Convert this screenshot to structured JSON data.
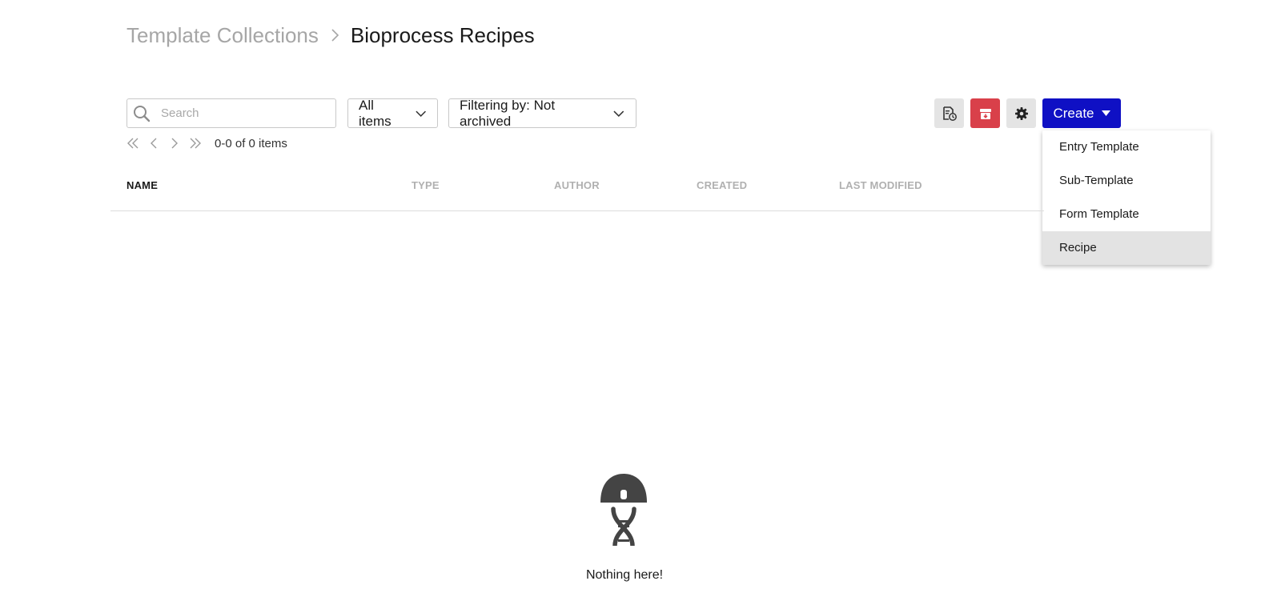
{
  "breadcrumb": {
    "parent": "Template Collections",
    "current": "Bioprocess Recipes"
  },
  "search": {
    "placeholder": "Search",
    "value": ""
  },
  "filters": {
    "items_selected": "All items",
    "archive_filter": "Filtering by: Not archived"
  },
  "pager": {
    "count_text": "0-0 of 0 items"
  },
  "toolbar": {
    "create_label": "Create",
    "colors": {
      "create": "#0f10c4",
      "archive": "#d9404a",
      "neutral": "#e4e4e4"
    }
  },
  "create_menu": {
    "items": [
      {
        "label": "Entry Template"
      },
      {
        "label": "Sub-Template"
      },
      {
        "label": "Form Template"
      },
      {
        "label": "Recipe",
        "highlighted": true
      }
    ]
  },
  "table": {
    "columns": [
      "NAME",
      "TYPE",
      "AUTHOR",
      "CREATED",
      "LAST MODIFIED"
    ]
  },
  "empty_state": {
    "message": "Nothing here!"
  }
}
